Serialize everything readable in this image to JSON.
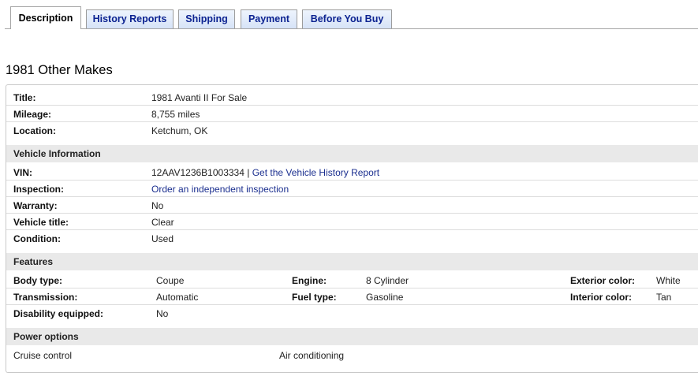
{
  "tabs": [
    {
      "label": "Description",
      "active": true
    },
    {
      "label": "History Reports",
      "active": false
    },
    {
      "label": "Shipping",
      "active": false
    },
    {
      "label": "Payment",
      "active": false
    },
    {
      "label": "Before You Buy",
      "active": false
    }
  ],
  "page_title": "1981 Other Makes",
  "basic": {
    "title_label": "Title:",
    "title_value": "1981 Avanti II For Sale",
    "mileage_label": "Mileage:",
    "mileage_value": "8,755 miles",
    "location_label": "Location:",
    "location_value": "Ketchum, OK"
  },
  "vehicle_info": {
    "heading": "Vehicle Information",
    "vin_label": "VIN:",
    "vin_value": "12AAV1236B1003334",
    "vin_separator": "|",
    "vin_link": "Get the Vehicle History Report",
    "inspection_label": "Inspection:",
    "inspection_link": "Order an independent inspection",
    "warranty_label": "Warranty:",
    "warranty_value": "No",
    "vehicle_title_label": "Vehicle title:",
    "vehicle_title_value": "Clear",
    "condition_label": "Condition:",
    "condition_value": "Used"
  },
  "features": {
    "heading": "Features",
    "body_type_label": "Body type:",
    "body_type_value": "Coupe",
    "engine_label": "Engine:",
    "engine_value": "8 Cylinder",
    "exterior_color_label": "Exterior color:",
    "exterior_color_value": "White",
    "transmission_label": "Transmission:",
    "transmission_value": "Automatic",
    "fuel_type_label": "Fuel type:",
    "fuel_type_value": "Gasoline",
    "interior_color_label": "Interior color:",
    "interior_color_value": "Tan",
    "disability_label": "Disability equipped:",
    "disability_value": "No"
  },
  "power_options": {
    "heading": "Power options",
    "items": [
      "Cruise control",
      "Air conditioning"
    ]
  },
  "colors": {
    "link": "#1b2f8f",
    "tab_text": "#0c2391",
    "section_bg": "#e9e9e9"
  }
}
